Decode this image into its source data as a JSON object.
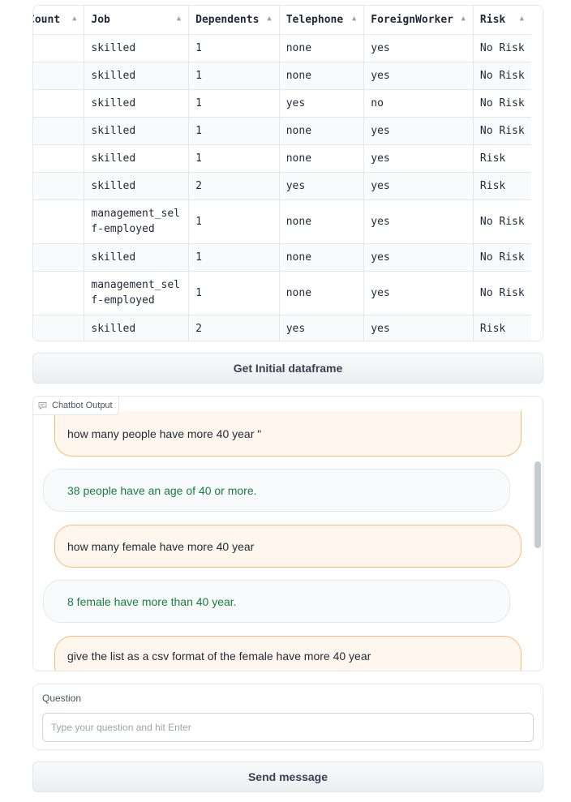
{
  "table": {
    "columns": [
      {
        "label": "Count",
        "sort_icon": "sort-up-icon"
      },
      {
        "label": "Job",
        "sort_icon": "sort-up-icon"
      },
      {
        "label": "Dependents",
        "sort_icon": "sort-up-icon"
      },
      {
        "label": "Telephone",
        "sort_icon": "sort-up-icon"
      },
      {
        "label": "ForeignWorker",
        "sort_icon": "sort-up-icon"
      },
      {
        "label": "Risk",
        "sort_icon": "sort-up-icon"
      }
    ],
    "rows": [
      [
        "",
        "skilled",
        "1",
        "none",
        "yes",
        "No Risk"
      ],
      [
        "",
        "skilled",
        "1",
        "none",
        "yes",
        "No Risk"
      ],
      [
        "",
        "skilled",
        "1",
        "yes",
        "no",
        "No Risk"
      ],
      [
        "",
        "skilled",
        "1",
        "none",
        "yes",
        "No Risk"
      ],
      [
        "",
        "skilled",
        "1",
        "none",
        "yes",
        "Risk"
      ],
      [
        "",
        "skilled",
        "2",
        "yes",
        "yes",
        "Risk"
      ],
      [
        "",
        "management_self-employed",
        "1",
        "none",
        "yes",
        "No Risk"
      ],
      [
        "",
        "skilled",
        "1",
        "none",
        "yes",
        "No Risk"
      ],
      [
        "",
        "management_self-employed",
        "1",
        "none",
        "yes",
        "No Risk"
      ],
      [
        "",
        "skilled",
        "2",
        "yes",
        "yes",
        "Risk"
      ]
    ]
  },
  "initial_button": {
    "label": "Get Initial dataframe"
  },
  "chatbot": {
    "label": "Chatbot Output",
    "label_icon": "chat-icon",
    "messages": [
      {
        "role": "user",
        "text": "how many people have more 40 year \""
      },
      {
        "role": "bot",
        "text": "38 people have an age of 40 or more."
      },
      {
        "role": "user",
        "text": "how many female have more 40 year"
      },
      {
        "role": "bot",
        "text": "8 female have more than 40 year."
      },
      {
        "role": "user",
        "text": "give the list as a csv format of the female have more 40 year"
      }
    ]
  },
  "question": {
    "label": "Question",
    "placeholder": "Type your question and hit Enter",
    "value": ""
  },
  "send_button": {
    "label": "Send message"
  },
  "colors": {
    "user_bubble_bg": "#fff7ed",
    "user_bubble_border": "#fdba74",
    "bot_text": "#15803d"
  }
}
